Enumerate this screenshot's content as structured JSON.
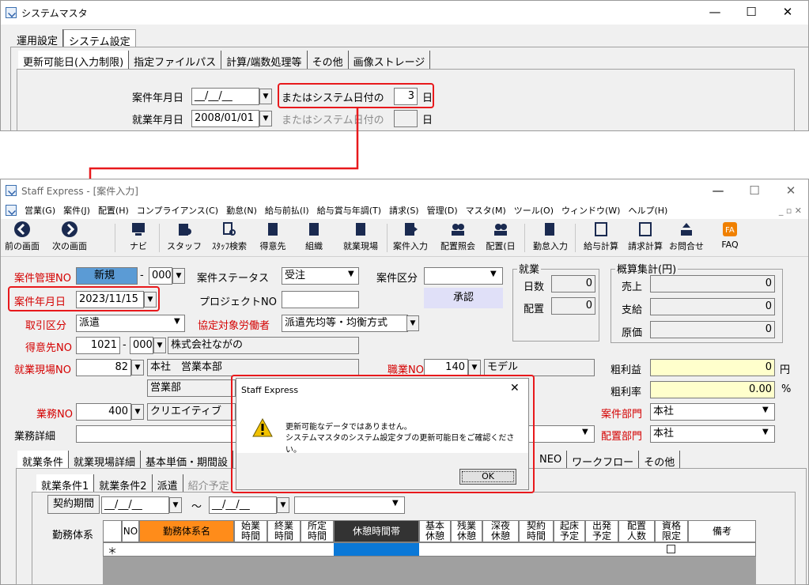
{
  "top": {
    "title": "システムマスタ",
    "controls": [
      "—",
      "☐",
      "✕"
    ],
    "tabs": [
      "運用設定",
      "システム設定"
    ],
    "subtabs": [
      "更新可能日(入力制限)",
      "指定ファイルパス",
      "計算/端数処理等",
      "その他",
      "画像ストレージ"
    ],
    "row1": {
      "label": "案件年月日",
      "value": "__/__/__",
      "or": "またはシステム日付の",
      "days": "3",
      "unit": "日"
    },
    "row2": {
      "label": "就業年月日",
      "value": "2008/01/01",
      "or": "またはシステム日付の",
      "unit": "日"
    }
  },
  "main": {
    "title": "Staff Express - [案件入力]",
    "controls": [
      "—",
      "☐",
      "✕"
    ],
    "menu": [
      "営業(G)",
      "案件(J)",
      "配置(H)",
      "コンプライアンス(C)",
      "勤怠(N)",
      "給与前払(I)",
      "給与賞与年調(T)",
      "請求(S)",
      "管理(D)",
      "マスタ(M)",
      "ツール(O)",
      "ウィンドウ(W)",
      "ヘルプ(H)"
    ],
    "toolbar": [
      "前の画面",
      "次の画面",
      "ナビ",
      "スタッフ",
      "ｽﾀｯﾌ検索",
      "得意先",
      "組織",
      "就業現場",
      "案件入力",
      "配置照会",
      "配置(日",
      "勤怠入力",
      "給与計算",
      "請求計算",
      "お問合せ",
      "FAQ"
    ],
    "form": {
      "anken_no_label": "案件管理NO",
      "anken_no": "新規",
      "anken_no_sub": "000",
      "status_label": "案件ステータス",
      "status": "受注",
      "kubun_label": "案件区分",
      "date_label": "案件年月日",
      "date": "2023/11/15",
      "project_label": "プロジェクトNO",
      "approve": "承認",
      "torihiki_label": "取引区分",
      "torihiki": "派遣",
      "kyotei_label": "協定対象労働者",
      "kyotei": "派遣先均等・均衡方式",
      "tokui_label": "得意先NO",
      "tokui_no": "1021",
      "tokui_sub": "000",
      "tokui_name": "株式会社ながの",
      "genba_label": "就業現場NO",
      "genba_no": "82",
      "genba_name": "本社　営業本部",
      "genba_dept": "営業部",
      "shokugyo_label": "職業NO",
      "shokugyo_no": "140",
      "shokugyo_name": "モデル",
      "gyomu_label": "業務NO",
      "gyomu_no": "400",
      "gyomu_name": "クリエイティブ",
      "gyomu_detail_label": "業務詳細",
      "bumon_label": "案件部門",
      "bumon": "本社",
      "haichi_bumon_label": "配置部門",
      "haichi_bumon": "本社"
    },
    "shugyo": {
      "title": "就業",
      "days_label": "日数",
      "days": "0",
      "haichi_label": "配置",
      "haichi": "0"
    },
    "gaisan": {
      "title": "概算集計(円)",
      "uriage_label": "売上",
      "uriage": "0",
      "shikyu_label": "支給",
      "shikyu": "0",
      "genka_label": "原価",
      "genka": "0"
    },
    "arari": {
      "label": "粗利益",
      "value": "0",
      "unit": "円",
      "rate_label": "粗利率",
      "rate": "0.00",
      "rate_unit": "%"
    },
    "tabs": [
      "就業条件",
      "就業現場詳細",
      "基本単価・期間設",
      "NEO",
      "ワークフロー",
      "その他"
    ],
    "subtabs": [
      "就業条件1",
      "就業条件2",
      "派遣",
      "紹介予定"
    ],
    "period_label": "契約期間",
    "period_from": "__/__/__",
    "tilde": "〜",
    "period_to": "__/__/__",
    "kinmu_label": "勤務体系",
    "grid_headers": [
      "NO",
      "勤務体系名",
      "始業\n時間",
      "終業\n時間",
      "所定\n時間",
      "休憩時間帯",
      "基本\n休憩",
      "残業\n休憩",
      "深夜\n休憩",
      "契約\n時間",
      "起床\n予定",
      "出発\n予定",
      "配置\n人数",
      "資格\n限定",
      "備考"
    ],
    "new_row": "＊"
  },
  "dialog": {
    "title": "Staff Express",
    "close": "✕",
    "line1": "更新可能なデータではありません。",
    "line2": "システムマスタのシステム設定タブの更新可能日をご確認ください。",
    "ok": "OK"
  },
  "colors": {
    "accent_red": "#e8191c",
    "orange": "#ff8c1a",
    "blue": "#0a78d7",
    "yellow": "#ffffcc"
  }
}
